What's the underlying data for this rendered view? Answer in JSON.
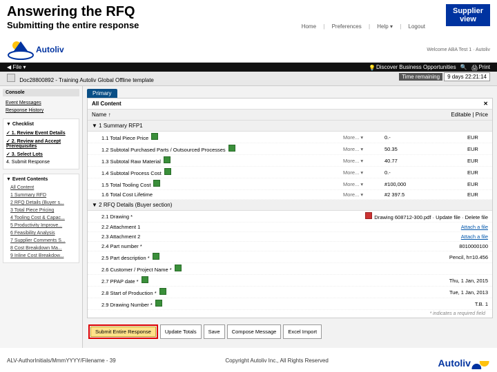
{
  "title": {
    "main": "Answering the RFQ",
    "sub": "Submitting the entire response"
  },
  "supplier_badge": {
    "line1": "Supplier",
    "line2": "view"
  },
  "topnav": {
    "home": "Home",
    "prefs": "Preferences",
    "help": "Help ▾",
    "logout": "Logout"
  },
  "brand": "Autoliv",
  "header_right": "Welcome ABA Test 1 · Autoliv",
  "blackbar": {
    "file": "◀ File ▾",
    "discover": "Discover Business Opportunities",
    "search": "🔍",
    "print": "Print"
  },
  "doc_title": "Doc28800892 - Training Autoliv Global Offline template",
  "time_label": "Time remaining",
  "time_value": "9 days 22:21:14",
  "sidebar": {
    "console": "Console",
    "event_msgs": "Event Messages",
    "resp_history": "Response History",
    "checklist_title": "▼ Checklist",
    "checklist": [
      "✓ 1. Review Event Details",
      "✓ 2. Review and Accept Prerequisites",
      "✓ 3. Select Lots",
      "4. Submit Response"
    ],
    "contents_title": "▼ Event Contents",
    "contents": [
      "All Content",
      "1 Summary RFD",
      "2 RFQ Details (Buyer s...",
      "3 Total Piece Pricing",
      "4 Tooling Cost & Capac...",
      "5 Productivity Improve...",
      "6 Feasibility Analysis",
      "7 Supplier Comments S...",
      "8 Cost Breakdown Ma...",
      "9 Inline Cost Breakdow..."
    ]
  },
  "tab": "Primary",
  "panel_title": "All Content",
  "section_labels": {
    "name": "Name ↑",
    "editable": "Editable | Price"
  },
  "sections": [
    {
      "header": "▼ 1  Summary RFP1",
      "rows": [
        {
          "label": "1.1  Total Piece Price",
          "xls": true,
          "meta": "More... ▾",
          "value": "0.- ",
          "unit": "EUR"
        },
        {
          "label": "1.2  Subtotal Purchased Parts / Outsourced Processes",
          "xls": true,
          "meta": "More... ▾",
          "value": "50.35",
          "unit": "EUR"
        },
        {
          "label": "1.3  Subtotal Raw Material",
          "xls": true,
          "meta": "More... ▾",
          "value": "40.77",
          "unit": "EUR"
        },
        {
          "label": "1.4  Subtotal Process Cost",
          "xls": true,
          "meta": "More... ▾",
          "value": "0.- ",
          "unit": "EUR"
        },
        {
          "label": "1.5  Total Tooling Cost",
          "xls": true,
          "meta": "More... ▾",
          "value": "#100,000",
          "unit": "EUR"
        },
        {
          "label": "1.6  Total Cost Lifetime",
          "xls": false,
          "meta": "More... ▾",
          "value": "#2 397.5",
          "unit": "EUR"
        }
      ]
    },
    {
      "header": "▼ 2  RFQ Details (Buyer section)",
      "rows": [
        {
          "label": "2.1  Drawing *",
          "attach": "Drawing 608712-300.pdf",
          "trail": " · Update file · Delete file"
        },
        {
          "label": "2.2  Attachment 1",
          "attach_link": "Attach a file"
        },
        {
          "label": "2.3  Attachment 2",
          "attach_link": "Attach a file"
        },
        {
          "label": "2.4  Part number *",
          "value": "8010000100"
        },
        {
          "label": "2.5  Part description *",
          "xls": true,
          "value": "Pencil, h=10.456"
        },
        {
          "label": "2.6  Customer / Project Name *",
          "xls": true,
          "value": ""
        },
        {
          "label": "2.7  PPAP date *",
          "xls": true,
          "value": "Thu, 1 Jan, 2015"
        },
        {
          "label": "2.8  Start of Production *",
          "xls": true,
          "value": "Tue, 1 Jan, 2013"
        },
        {
          "label": "2.9  Drawing Number *",
          "xls": true,
          "value": "T.B. 1"
        }
      ]
    }
  ],
  "required_note": "* indicates a required field",
  "buttons": {
    "submit": "Submit Entire Response",
    "update": "Update Totals",
    "save": "Save",
    "compose": "Compose Message",
    "export": "Excel Import"
  },
  "footer": {
    "left": "ALV-AuthorInitials/MmmYYYY/Filename - 39",
    "center": "Copyright Autoliv Inc., All Rights Reserved"
  }
}
